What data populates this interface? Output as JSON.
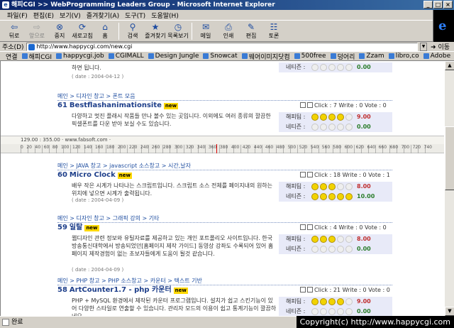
{
  "window": {
    "title": "해피CGI >> WebProgramming Leaders Group - Microsoft Internet Explorer"
  },
  "menu": [
    "파일(F)",
    "편집(E)",
    "보기(V)",
    "즐겨찾기(A)",
    "도구(T)",
    "도움말(H)"
  ],
  "toolbar": [
    {
      "label": "뒤로",
      "icon": "back-icon",
      "disabled": false
    },
    {
      "label": "앞으로",
      "icon": "forward-icon",
      "disabled": true
    },
    {
      "label": "중지",
      "icon": "stop-icon",
      "disabled": false
    },
    {
      "label": "새로고침",
      "icon": "refresh-icon",
      "disabled": false
    },
    {
      "label": "홈",
      "icon": "home-icon",
      "disabled": false
    },
    {
      "label": "검색",
      "icon": "search-icon",
      "disabled": false
    },
    {
      "label": "즐겨찾기",
      "icon": "favorites-icon",
      "disabled": false
    },
    {
      "label": "목록보기",
      "icon": "history-icon",
      "disabled": false
    },
    {
      "label": "메일",
      "icon": "mail-icon",
      "disabled": false
    },
    {
      "label": "인쇄",
      "icon": "print-icon",
      "disabled": false
    },
    {
      "label": "편집",
      "icon": "edit-icon",
      "disabled": false
    },
    {
      "label": "토론",
      "icon": "discuss-icon",
      "disabled": false
    }
  ],
  "address": {
    "label": "주소(D)",
    "url": "http://www.happycgi.com/new.cgi",
    "go_label": "이동"
  },
  "links": {
    "label": "연결",
    "items": [
      "해피CGI",
      "happycgi.job",
      "CGIMALL",
      "Design Jungle",
      "Snowcat",
      "웨어이미지닷컴",
      "500free",
      "덩어리",
      "Zzam",
      "libro,co",
      "Adobe"
    ]
  },
  "top_partial": {
    "desc_fragment": "하면 됩니다.",
    "date": "( date : 2004-04-12 )",
    "friend_label": "네티즌 :",
    "friend_score": "0.00"
  },
  "posts": [
    {
      "crumb": "메인 > 디자인 창고 > 폰트 모음",
      "num": "61",
      "title": "Bestflashanimationsite",
      "new": "new",
      "stats": "Click : 7 Write : 0 Vote : 0",
      "desc": "다양하고 멋진 플래시 작품들 만나 볼수 있는 곳입니다. 이외에도 여러 종류의 깔끔한 픽셀폰트를 다운 받아 보실 수도 있습니다.",
      "expert_label": "해피팀 :",
      "expert_score": "9.00",
      "expert_faces": 4,
      "netizen_label": "네티즌 :",
      "netizen_score": "0.00",
      "netizen_faces": 0
    },
    {
      "crumb": "메인 > JAVA 창고 > javascript 소스창고 > 시간,날자",
      "num": "60",
      "title": "Micro Clock",
      "new": "new",
      "stats": "Click : 18 Write : 0 Vote : 1",
      "desc": "배우 작은 시계가 나타나는 스크립트입니다. 스크립트 소스 전체를 페이지내의 원하는 위치에 넣으면 시계가 출력됩니다.",
      "date": "( date : 2004-04-09 )",
      "expert_label": "해피팀 :",
      "expert_score": "8.00",
      "expert_faces": 3,
      "netizen_label": "네티즌 :",
      "netizen_score": "10.00",
      "netizen_faces": 5
    },
    {
      "crumb": "메인 > 디자인 창고 > 그래픽 강의 > 기타",
      "num": "59",
      "title": "일탈",
      "new": "new",
      "stats": "Click : 4 Write : 0 Vote : 0",
      "desc": "웹디자인 관련 정보와 유틸자료를 제공하고 있는 개인 포트폴리오 사이트입니다. 한국방송통신대학에서 방송되었던[홈페이지 제작 가이드] 동영상 강좌도 수록되어 있어 홈페이지 제작경험이 없는 초보자들에게 도움이 될것 같습니다.",
      "date": "( date : 2004-04-09 )",
      "expert_label": "해피팀 :",
      "expert_score": "8.00",
      "expert_faces": 3,
      "netizen_label": "네티즌 :",
      "netizen_score": "0.00",
      "netizen_faces": 0
    },
    {
      "crumb": "메인 > PHP 창고 > PHP 소스창고 > 카운터 > 텍스트 기반",
      "num": "58",
      "title": "ArtCounter1.7 - php 카운터",
      "new": "new",
      "stats": "Click : 21 Write : 0 Vote : 0",
      "desc": "PHP + MySQL 환경에서 제작된 카운터 프로그램입니다. 설치가 쉽고 스킨기능이 있어 다양한 스타일로 연출할 수 있습니다. 관리자 모드의 이용이 쉽고 통계기능이 깔끔하네요.",
      "expert_label": "해피팀 :",
      "expert_score": "9.00",
      "expert_faces": 4,
      "netizen_label": "네티즌 :",
      "netizen_score": "0.00",
      "netizen_faces": 0
    }
  ],
  "ruler": {
    "readout": "129.00 : 355.00 · www.fabsoft.com ·",
    "ticks": [
      "0",
      "20",
      "40",
      "60",
      "80",
      "100",
      "120",
      "140",
      "160",
      "180",
      "200",
      "220",
      "240",
      "260",
      "280",
      "300",
      "320",
      "340",
      "360",
      "380",
      "400",
      "420",
      "440",
      "460",
      "480",
      "500",
      "520",
      "540",
      "560",
      "580",
      "600",
      "620",
      "640",
      "660",
      "680",
      "700",
      "720",
      "740"
    ]
  },
  "status": {
    "text": "완료"
  },
  "watermark": "Copyright(c) http://www.happycgi.com"
}
